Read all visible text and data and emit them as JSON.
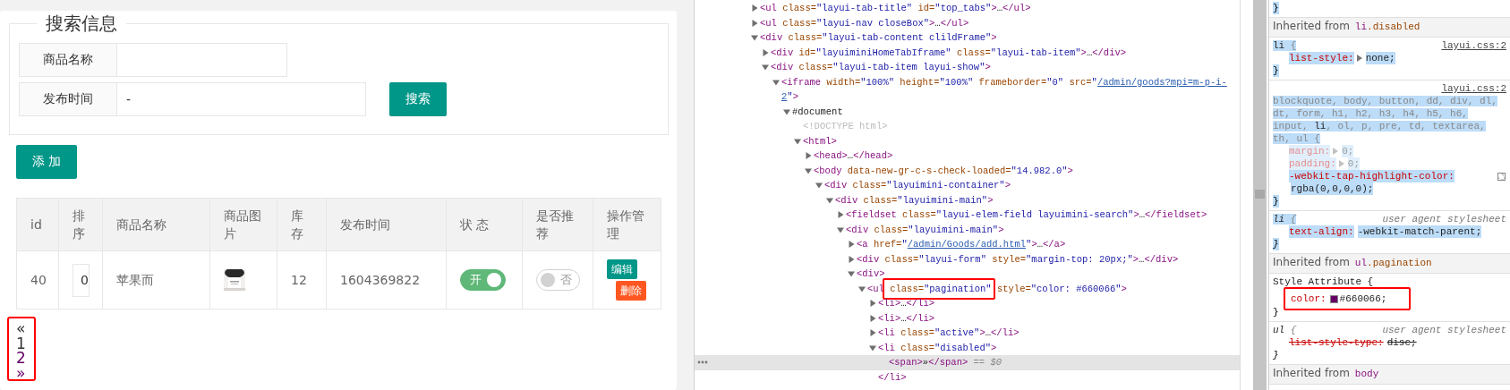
{
  "goods_page": {
    "search": {
      "legend": "搜索信息",
      "fields": [
        {
          "label": "商品名称"
        },
        {
          "label": "发布时间",
          "value": "-"
        }
      ],
      "button": "搜索"
    },
    "add_button": "添 加",
    "table": {
      "columns": [
        "id",
        "排序",
        "商品名称",
        "商品图片",
        "库存",
        "发布时间",
        "状 态",
        "是否推荐",
        "操作管理"
      ],
      "rows": [
        {
          "id": "40",
          "sort": "0",
          "name": "苹果而",
          "image": {
            "kind": "picture"
          },
          "stock": "12",
          "published": "1604369822",
          "status": {
            "on": true,
            "label": "开"
          },
          "recommended": {
            "on": false,
            "label": "否"
          },
          "actions": [
            {
              "kind": "edit",
              "label": "编辑"
            },
            {
              "kind": "delete",
              "label": "删除"
            }
          ]
        }
      ]
    },
    "pagination": {
      "annotated": true,
      "items": [
        {
          "label": "«",
          "color": "#333333"
        },
        {
          "label": "1",
          "color": "#333333"
        },
        {
          "label": "2",
          "color": "#660066"
        },
        {
          "label": "»",
          "color": "#660066"
        }
      ]
    }
  },
  "elements": {
    "nodes": [
      {
        "expanded": false,
        "selected": false,
        "tokens": [
          {
            "kind": "tag",
            "text": "<ul"
          },
          {
            "kind": "attr",
            "text": " class="
          },
          {
            "kind": "value",
            "text": "\"layui-tab-title\""
          },
          {
            "kind": "attr",
            "text": " id="
          },
          {
            "kind": "value",
            "text": "\"top_tabs\""
          },
          {
            "kind": "tag",
            "text": ">"
          },
          {
            "kind": "plain",
            "text": "…"
          },
          {
            "kind": "tag",
            "text": "</ul>"
          }
        ]
      },
      {
        "expanded": false,
        "selected": false,
        "tokens": [
          {
            "kind": "tag",
            "text": "<ul"
          },
          {
            "kind": "attr",
            "text": " class="
          },
          {
            "kind": "value",
            "text": "\"layui-nav closeBox\""
          },
          {
            "kind": "tag",
            "text": ">"
          },
          {
            "kind": "plain",
            "text": "…"
          },
          {
            "kind": "tag",
            "text": "</ul>"
          }
        ]
      },
      {
        "expanded": true,
        "selected": false,
        "tokens": [
          {
            "kind": "tag",
            "text": "<div"
          },
          {
            "kind": "attr",
            "text": " class="
          },
          {
            "kind": "value",
            "text": "\"layui-tab-content clildFrame\""
          },
          {
            "kind": "tag",
            "text": ">"
          }
        ],
        "children": [
          {
            "expanded": false,
            "selected": false,
            "tokens": [
              {
                "kind": "tag",
                "text": "<div"
              },
              {
                "kind": "attr",
                "text": " id="
              },
              {
                "kind": "value",
                "text": "\"layuiminiHomeTabIframe\""
              },
              {
                "kind": "attr",
                "text": " class="
              },
              {
                "kind": "value",
                "text": "\"layui-tab-item\""
              },
              {
                "kind": "tag",
                "text": ">"
              },
              {
                "kind": "plain",
                "text": "…"
              },
              {
                "kind": "tag",
                "text": "</div>"
              }
            ]
          },
          {
            "expanded": true,
            "selected": false,
            "tokens": [
              {
                "kind": "tag",
                "text": "<div"
              },
              {
                "kind": "attr",
                "text": " class="
              },
              {
                "kind": "value",
                "text": "\"layui-tab-item layui-show\""
              },
              {
                "kind": "tag",
                "text": ">"
              }
            ],
            "children": [
              {
                "expanded": true,
                "selected": false,
                "tokens": [
                  {
                    "kind": "tag",
                    "text": "<iframe"
                  },
                  {
                    "kind": "attr",
                    "text": " width="
                  },
                  {
                    "kind": "value",
                    "text": "\"100%\""
                  },
                  {
                    "kind": "attr",
                    "text": " height="
                  },
                  {
                    "kind": "value",
                    "text": "\"100%\""
                  },
                  {
                    "kind": "attr",
                    "text": " frameborder="
                  },
                  {
                    "kind": "value",
                    "text": "\"0\""
                  },
                  {
                    "kind": "attr",
                    "text": " src="
                  },
                  {
                    "kind": "value",
                    "text": "\""
                  },
                  {
                    "kind": "link",
                    "text": "/admin/goods?mpi=m-p-i-"
                  },
                  {
                    "kind": "break"
                  },
                  {
                    "kind": "link",
                    "text": "2"
                  },
                  {
                    "kind": "value",
                    "text": "\""
                  },
                  {
                    "kind": "tag",
                    "text": ">"
                  }
                ],
                "children": [
                  {
                    "expanded": true,
                    "selected": false,
                    "tokens": [
                      {
                        "kind": "node",
                        "text": "#document"
                      }
                    ],
                    "children": [
                      {
                        "selected": false,
                        "tokens": [
                          {
                            "kind": "muted",
                            "text": "<!DOCTYPE html>"
                          }
                        ]
                      },
                      {
                        "expanded": true,
                        "selected": false,
                        "tokens": [
                          {
                            "kind": "tag",
                            "text": "<html>"
                          }
                        ],
                        "children": [
                          {
                            "expanded": false,
                            "selected": false,
                            "tokens": [
                              {
                                "kind": "tag",
                                "text": "<head>"
                              },
                              {
                                "kind": "plain",
                                "text": "…"
                              },
                              {
                                "kind": "tag",
                                "text": "</head>"
                              }
                            ]
                          },
                          {
                            "expanded": true,
                            "selected": false,
                            "tokens": [
                              {
                                "kind": "tag",
                                "text": "<body"
                              },
                              {
                                "kind": "attr",
                                "text": " data-new-gr-c-s-check-loaded="
                              },
                              {
                                "kind": "value",
                                "text": "\"14.982.0\""
                              },
                              {
                                "kind": "tag",
                                "text": ">"
                              }
                            ],
                            "children": [
                              {
                                "expanded": true,
                                "selected": false,
                                "tokens": [
                                  {
                                    "kind": "tag",
                                    "text": "<div"
                                  },
                                  {
                                    "kind": "attr",
                                    "text": " class="
                                  },
                                  {
                                    "kind": "value",
                                    "text": "\"layuimini-container\""
                                  },
                                  {
                                    "kind": "tag",
                                    "text": ">"
                                  }
                                ],
                                "children": [
                                  {
                                    "expanded": true,
                                    "selected": false,
                                    "tokens": [
                                      {
                                        "kind": "tag",
                                        "text": "<div"
                                      },
                                      {
                                        "kind": "attr",
                                        "text": " class="
                                      },
                                      {
                                        "kind": "value",
                                        "text": "\"layuimini-main\""
                                      },
                                      {
                                        "kind": "tag",
                                        "text": ">"
                                      }
                                    ],
                                    "children": [
                                      {
                                        "expanded": false,
                                        "selected": false,
                                        "tokens": [
                                          {
                                            "kind": "tag",
                                            "text": "<fieldset"
                                          },
                                          {
                                            "kind": "attr",
                                            "text": " class="
                                          },
                                          {
                                            "kind": "value",
                                            "text": "\"layui-elem-field layuimini-search\""
                                          },
                                          {
                                            "kind": "tag",
                                            "text": ">"
                                          },
                                          {
                                            "kind": "plain",
                                            "text": "…"
                                          },
                                          {
                                            "kind": "tag",
                                            "text": "</fieldset>"
                                          }
                                        ]
                                      },
                                      {
                                        "expanded": true,
                                        "selected": false,
                                        "tokens": [
                                          {
                                            "kind": "tag",
                                            "text": "<div"
                                          },
                                          {
                                            "kind": "attr",
                                            "text": " class="
                                          },
                                          {
                                            "kind": "value",
                                            "text": "\"layuimini-main\""
                                          },
                                          {
                                            "kind": "tag",
                                            "text": ">"
                                          }
                                        ],
                                        "children": [
                                          {
                                            "expanded": false,
                                            "selected": false,
                                            "tokens": [
                                              {
                                                "kind": "tag",
                                                "text": "<a"
                                              },
                                              {
                                                "kind": "attr",
                                                "text": " href="
                                              },
                                              {
                                                "kind": "value",
                                                "text": "\""
                                              },
                                              {
                                                "kind": "link",
                                                "text": "/admin/Goods/add.html"
                                              },
                                              {
                                                "kind": "value",
                                                "text": "\""
                                              },
                                              {
                                                "kind": "tag",
                                                "text": ">"
                                              },
                                              {
                                                "kind": "plain",
                                                "text": "…"
                                              },
                                              {
                                                "kind": "tag",
                                                "text": "</a>"
                                              }
                                            ]
                                          },
                                          {
                                            "expanded": false,
                                            "selected": false,
                                            "tokens": [
                                              {
                                                "kind": "tag",
                                                "text": "<div"
                                              },
                                              {
                                                "kind": "attr",
                                                "text": " class="
                                              },
                                              {
                                                "kind": "value",
                                                "text": "\"layui-form\""
                                              },
                                              {
                                                "kind": "attr",
                                                "text": " style="
                                              },
                                              {
                                                "kind": "value",
                                                "text": "\"margin-top: 20px;\""
                                              },
                                              {
                                                "kind": "tag",
                                                "text": ">"
                                              },
                                              {
                                                "kind": "plain",
                                                "text": "…"
                                              },
                                              {
                                                "kind": "tag",
                                                "text": "</div>"
                                              }
                                            ]
                                          },
                                          {
                                            "expanded": true,
                                            "selected": false,
                                            "tokens": [
                                              {
                                                "kind": "tag",
                                                "text": "<div>"
                                              }
                                            ],
                                            "children": [
                                              {
                                                "expanded": true,
                                                "selected": false,
                                                "tokens": [
                                                  {
                                                    "kind": "tag",
                                                    "text": "<ul"
                                                  },
                                                  {
                                                    "kind": "group",
                                                    "annotated": true,
                                                    "tokens": [
                                                      {
                                                        "kind": "attr",
                                                        "text": " class="
                                                      },
                                                      {
                                                        "kind": "value",
                                                        "text": "\"pagination\""
                                                      }
                                                    ]
                                                  },
                                                  {
                                                    "kind": "attr",
                                                    "text": " style="
                                                  },
                                                  {
                                                    "kind": "value",
                                                    "text": "\"color: #660066\""
                                                  },
                                                  {
                                                    "kind": "tag",
                                                    "text": ">"
                                                  }
                                                ],
                                                "children": [
                                                  {
                                                    "expanded": false,
                                                    "selected": false,
                                                    "tokens": [
                                                      {
                                                        "kind": "tag",
                                                        "text": "<li>"
                                                      },
                                                      {
                                                        "kind": "plain",
                                                        "text": "…"
                                                      },
                                                      {
                                                        "kind": "tag",
                                                        "text": "</li>"
                                                      }
                                                    ]
                                                  },
                                                  {
                                                    "expanded": false,
                                                    "selected": false,
                                                    "tokens": [
                                                      {
                                                        "kind": "tag",
                                                        "text": "<li>"
                                                      },
                                                      {
                                                        "kind": "plain",
                                                        "text": "…"
                                                      },
                                                      {
                                                        "kind": "tag",
                                                        "text": "</li>"
                                                      }
                                                    ]
                                                  },
                                                  {
                                                    "expanded": false,
                                                    "selected": false,
                                                    "tokens": [
                                                      {
                                                        "kind": "tag",
                                                        "text": "<li"
                                                      },
                                                      {
                                                        "kind": "attr",
                                                        "text": " class="
                                                      },
                                                      {
                                                        "kind": "value",
                                                        "text": "\"active\""
                                                      },
                                                      {
                                                        "kind": "tag",
                                                        "text": ">"
                                                      },
                                                      {
                                                        "kind": "plain",
                                                        "text": "…"
                                                      },
                                                      {
                                                        "kind": "tag",
                                                        "text": "</li>"
                                                      }
                                                    ]
                                                  },
                                                  {
                                                    "expanded": true,
                                                    "selected": false,
                                                    "tokens": [
                                                      {
                                                        "kind": "tag",
                                                        "text": "<li"
                                                      },
                                                      {
                                                        "kind": "attr",
                                                        "text": " class="
                                                      },
                                                      {
                                                        "kind": "value",
                                                        "text": "\"disabled\""
                                                      },
                                                      {
                                                        "kind": "tag",
                                                        "text": ">"
                                                      }
                                                    ],
                                                    "closing": [
                                                      {
                                                        "kind": "tag",
                                                        "text": "</li>"
                                                      }
                                                    ],
                                                    "children": [
                                                      {
                                                        "selected": true,
                                                        "tokens": [
                                                          {
                                                            "kind": "tag",
                                                            "text": "<span>"
                                                          },
                                                          {
                                                            "kind": "plain",
                                                            "text": "»"
                                                          },
                                                          {
                                                            "kind": "tag",
                                                            "text": "</span>"
                                                          },
                                                          {
                                                            "kind": "dim",
                                                            "text": " == $0"
                                                          }
                                                        ]
                                                      }
                                                    ]
                                                  }
                                                ]
                                              }
                                            ]
                                          }
                                        ]
                                      }
                                    ]
                                  }
                                ]
                              }
                            ]
                          }
                        ]
                      }
                    ]
                  }
                ]
              }
            ]
          }
        ]
      }
    ]
  },
  "styles": {
    "sections": [
      {
        "kind": "brace",
        "text": "}",
        "highlighted": true
      },
      {
        "kind": "inherited",
        "label": "Inherited from",
        "tag": "li",
        "class": ".disabled"
      },
      {
        "kind": "rule",
        "source": {
          "kind": "author",
          "text": "layui.css:2"
        },
        "highlighted": true,
        "selector": [
          {
            "text": "li",
            "matched": true
          },
          {
            "text": " {",
            "matched": false
          }
        ],
        "properties": [
          {
            "name": "list-style:",
            "value": "none;",
            "expandable": true,
            "inactive": false,
            "overridden": false,
            "annotated": false
          }
        ],
        "close": "}"
      },
      {
        "kind": "rule",
        "source": {
          "kind": "author",
          "text": "layui.css:2"
        },
        "highlighted": true,
        "selector": [
          {
            "text": "blockquote, body, button, dd, div, dl, dt, form, h1, h2, h3, h4, h5, h6, input, ",
            "matched": false
          },
          {
            "text": "li",
            "matched": true
          },
          {
            "text": ", ol, p, pre, td, textarea, th, ul {",
            "matched": false
          }
        ],
        "properties": [
          {
            "name": "margin:",
            "value": "0;",
            "expandable": true,
            "inactive": true,
            "overridden": false,
            "annotated": false
          },
          {
            "name": "padding:",
            "value": "0;",
            "expandable": true,
            "inactive": true,
            "overridden": false,
            "annotated": false
          },
          {
            "name": "-webkit-tap-highlight-color:",
            "value": "rgba(0,0,0,0);",
            "swatch": {
              "kind": "transparent"
            },
            "expandable": false,
            "inactive": false,
            "overridden": false,
            "annotated": false
          }
        ],
        "close": "}"
      },
      {
        "kind": "rule",
        "source": {
          "kind": "user-agent",
          "text": "user agent stylesheet"
        },
        "highlighted": true,
        "selector": [
          {
            "text": "li",
            "matched": true
          },
          {
            "text": " {",
            "matched": false
          }
        ],
        "properties": [
          {
            "name": "text-align:",
            "value": "-webkit-match-parent;",
            "expandable": false,
            "inactive": false,
            "overridden": false,
            "annotated": false
          }
        ],
        "close": "}"
      },
      {
        "kind": "inherited",
        "label": "Inherited from",
        "tag": "ul",
        "class": ".pagination"
      },
      {
        "kind": "rule",
        "highlighted": false,
        "selector": [
          {
            "text": "Style Attribute {",
            "matched": true
          }
        ],
        "properties": [
          {
            "name": "color:",
            "value": "#660066;",
            "swatch": {
              "kind": "solid",
              "color": "#660066"
            },
            "expandable": false,
            "inactive": false,
            "overridden": false,
            "annotated": true
          }
        ],
        "close": "}"
      },
      {
        "kind": "rule",
        "source": {
          "kind": "user-agent",
          "text": "user agent stylesheet"
        },
        "highlighted": false,
        "selector": [
          {
            "text": "ul",
            "matched": true
          },
          {
            "text": " {",
            "matched": false
          }
        ],
        "properties": [
          {
            "name": "list-style-type:",
            "value": "disc;",
            "expandable": false,
            "inactive": false,
            "overridden": true,
            "annotated": false
          }
        ],
        "close": "}"
      },
      {
        "kind": "inherited",
        "label": "Inherited from",
        "tag": "body"
      }
    ]
  }
}
